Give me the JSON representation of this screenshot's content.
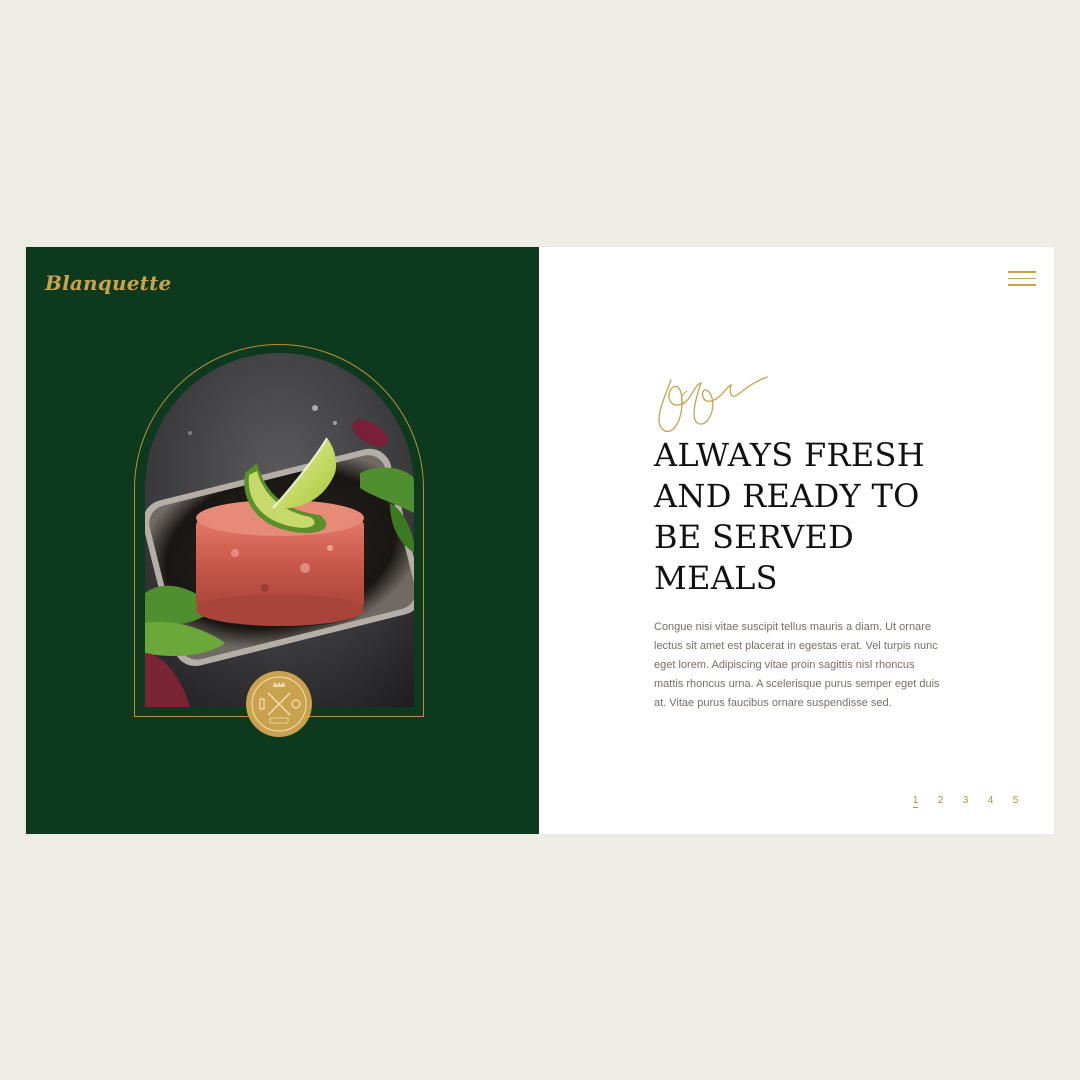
{
  "brand": {
    "name": "Blanquette",
    "color": "#c9a24f"
  },
  "colors": {
    "background": "#efece6",
    "left_panel": "#0d3a1e",
    "right_panel": "#ffffff",
    "accent_gold": "#c9a24f",
    "headline": "#111111",
    "body": "#7a6e64"
  },
  "header": {
    "menu_icon": "hamburger-menu-icon"
  },
  "hero": {
    "image_alt": "tuna tartare with avocado and lime",
    "seal_icon": "hxq-crest-seal"
  },
  "content": {
    "headline": "ALWAYS FRESH AND READY TO BE SERVED MEALS",
    "body": "Congue nisi vitae suscipit tellus mauris a diam. Ut ornare lectus sit amet est placerat in egestas erat. Vel turpis nunc eget lorem. Adipiscing vitae proin sagittis nisl rhoncus mattis rhoncus urna. A scelerisque purus semper eget duis at. Vitae purus faucibus ornare suspendisse sed."
  },
  "pagination": {
    "active": "1",
    "pages": [
      "1",
      "2",
      "3",
      "4",
      "5"
    ]
  }
}
